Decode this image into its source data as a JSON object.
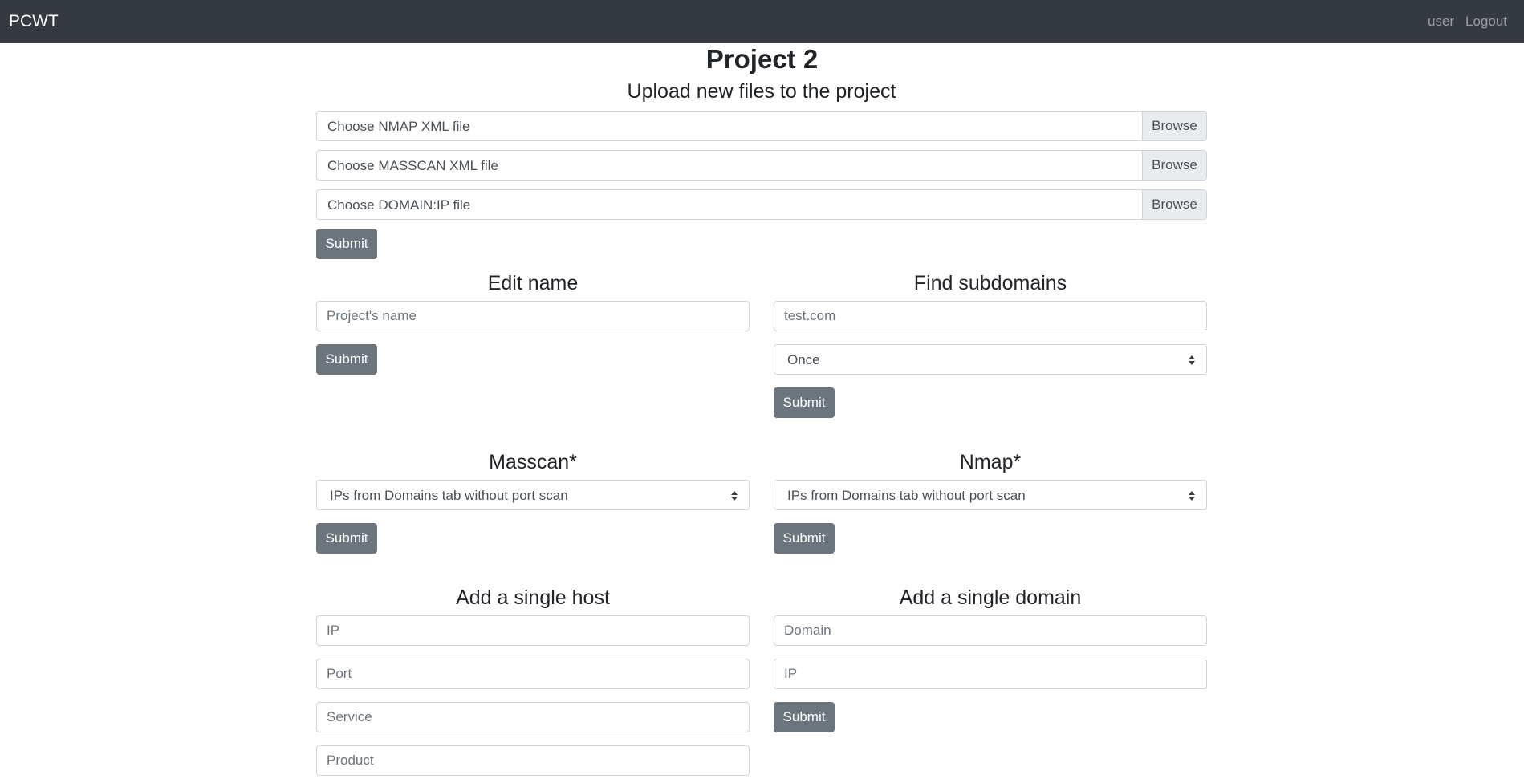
{
  "navbar": {
    "brand": "PCWT",
    "user_link": "user",
    "logout_link": "Logout"
  },
  "page_title": "Project 2",
  "upload": {
    "title": "Upload new files to the project",
    "nmap_label": "Choose NMAP XML file",
    "masscan_label": "Choose MASSCAN XML file",
    "domain_ip_label": "Choose DOMAIN:IP file",
    "browse_label": "Browse",
    "submit_label": "Submit"
  },
  "edit_name": {
    "title": "Edit name",
    "name_placeholder": "Project's name",
    "submit_label": "Submit"
  },
  "find_subdomains": {
    "title": "Find subdomains",
    "domain_placeholder": "test.com",
    "frequency_selected": "Once",
    "submit_label": "Submit"
  },
  "masscan": {
    "title": "Masscan*",
    "target_selected": "IPs from Domains tab without port scan",
    "submit_label": "Submit"
  },
  "nmap": {
    "title": "Nmap*",
    "target_selected": "IPs from Domains tab without port scan",
    "submit_label": "Submit"
  },
  "add_host": {
    "title": "Add a single host",
    "ip_placeholder": "IP",
    "port_placeholder": "Port",
    "service_placeholder": "Service",
    "product_placeholder": "Product"
  },
  "add_domain": {
    "title": "Add a single domain",
    "domain_placeholder": "Domain",
    "ip_placeholder": "IP",
    "submit_label": "Submit"
  },
  "icons": {
    "select_arrow": "sort-arrows-icon"
  }
}
